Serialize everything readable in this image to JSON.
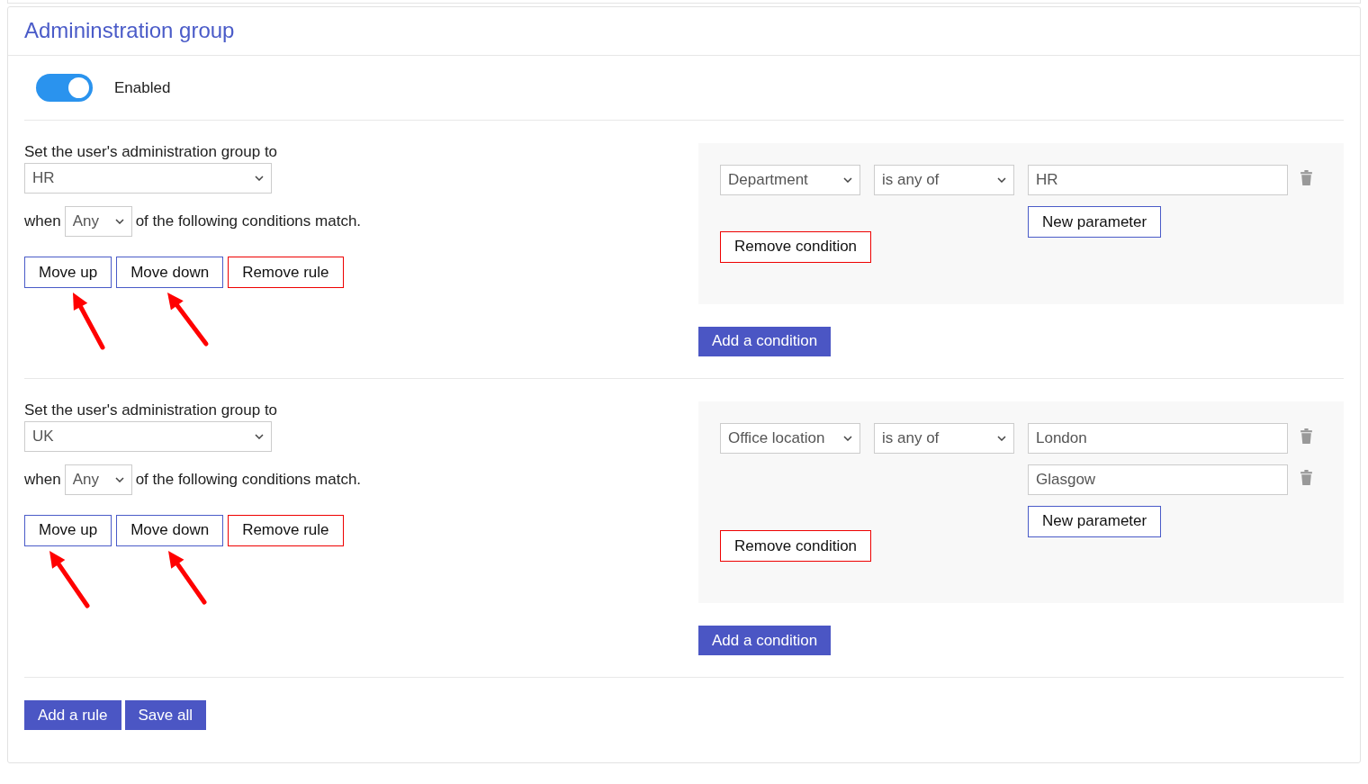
{
  "title": "Admininstration group",
  "toggle": {
    "label": "Enabled",
    "on": true
  },
  "rules": [
    {
      "prompt": "Set the user's administration group to",
      "group": "HR",
      "when": "when",
      "match": "Any",
      "suffix": "of the following conditions match.",
      "buttons": [
        {
          "kind": "move",
          "label": "Move up"
        },
        {
          "kind": "move",
          "label": "Move down"
        },
        {
          "kind": "remove",
          "label": "Remove rule"
        }
      ],
      "conditions": [
        {
          "field": "Department",
          "operator": "is any of",
          "values": [
            "HR"
          ],
          "new_parameter": "New parameter",
          "remove": "Remove condition"
        }
      ],
      "add_condition": "Add a condition"
    },
    {
      "prompt": "Set the user's administration group to",
      "group": "UK",
      "when": "when",
      "match": "Any",
      "suffix": "of the following conditions match.",
      "buttons": [
        {
          "kind": "move",
          "label": "Move up"
        },
        {
          "kind": "move",
          "label": "Move down"
        },
        {
          "kind": "remove",
          "label": "Remove rule"
        }
      ],
      "conditions": [
        {
          "field": "Office location",
          "operator": "is any of",
          "values": [
            "London",
            "Glasgow"
          ],
          "new_parameter": "New parameter",
          "remove": "Remove condition"
        }
      ],
      "add_condition": "Add a condition"
    }
  ],
  "footer_buttons": [
    "Add a rule",
    "Save all"
  ]
}
